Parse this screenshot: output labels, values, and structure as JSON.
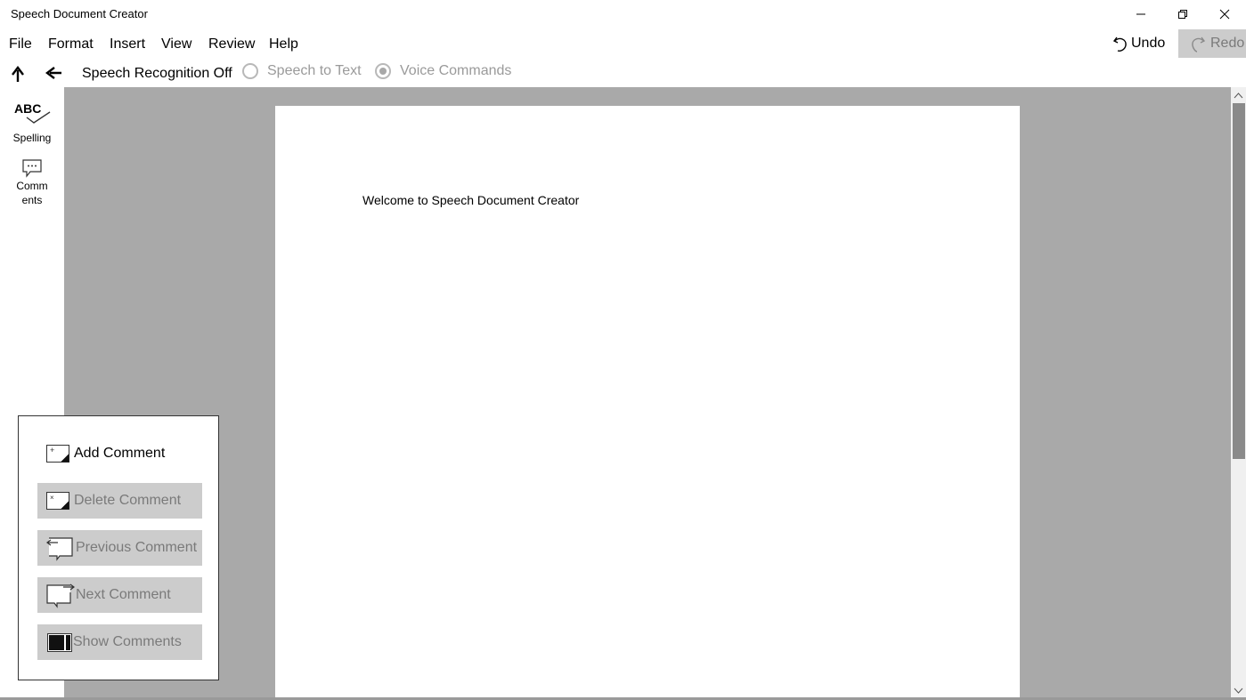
{
  "window": {
    "title": "Speech Document Creator"
  },
  "window_controls": {
    "minimize": "minimize-icon",
    "restore": "restore-icon",
    "close": "close-icon"
  },
  "menu": [
    {
      "label": "File"
    },
    {
      "label": "Format"
    },
    {
      "label": "Insert"
    },
    {
      "label": "View"
    },
    {
      "label": "Review"
    },
    {
      "label": "Help"
    }
  ],
  "history": {
    "undo_label": "Undo",
    "redo_label": "Redo",
    "redo_enabled": false
  },
  "toolbar": {
    "up_icon": "arrow-up-icon",
    "back_icon": "arrow-left-icon",
    "speech_recognition_status": "Speech Recognition Off",
    "modes": [
      {
        "label": "Speech to Text",
        "selected": false
      },
      {
        "label": "Voice Commands",
        "selected": true
      }
    ]
  },
  "side_panel": {
    "spelling_icon_text": "ABC",
    "spelling_label": "Spelling",
    "comments_label_line1": "Comm",
    "comments_label_line2": "ents"
  },
  "document": {
    "text": "Welcome to Speech Document Creator"
  },
  "comments_popup": {
    "add": "Add Comment",
    "delete": "Delete Comment",
    "previous": "Previous Comment",
    "next": "Next Comment",
    "show": "Show Comments"
  },
  "colors": {
    "canvas": "#a9a9a9",
    "disabled_button": "#cccccc",
    "disabled_text": "#7a7a7a"
  }
}
